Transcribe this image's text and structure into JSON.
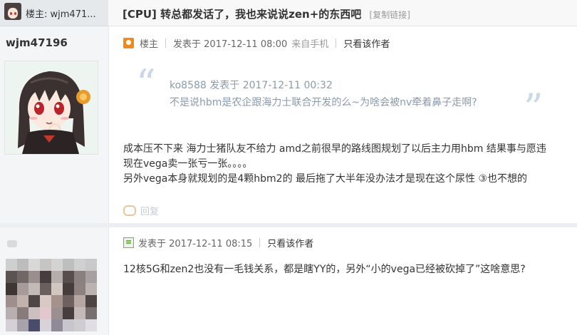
{
  "header": {
    "owner_label": "楼主: wjm471...",
    "title": "[CPU] 转总都发话了，我也来说说zen+的东西吧",
    "copy_link": "[复制链接]"
  },
  "post1": {
    "username": "wjm47196",
    "owner_badge": "楼主",
    "posted": "发表于 2017-12-11 08:00",
    "source": "来自手机",
    "only_author": "只看该作者",
    "quote": {
      "author": "ko8588 发表于 2017-12-11 00:32",
      "text": "不是说hbm是农企跟海力士联合开发的么~为啥会被nv牵着鼻子走啊?"
    },
    "body": [
      "成本压不下来 海力士猪队友不给力 amd之前很早的路线图规划了以后主力用hbm 结果事与愿违",
      "现在vega卖一张亏一张。。。。",
      "另外vega本身就规划的是4颗hbm2的 最后拖了大半年没办法才是现在这个尿性 ③也不想的"
    ],
    "reply": "回复"
  },
  "post2": {
    "posted": "发表于 2017-12-11 08:15",
    "only_author": "只看该作者",
    "text": "12核5G和zen2也没有一毛钱关系，都是瞎YY的，另外“小的vega已经被砍掉了”这啥意思?"
  }
}
